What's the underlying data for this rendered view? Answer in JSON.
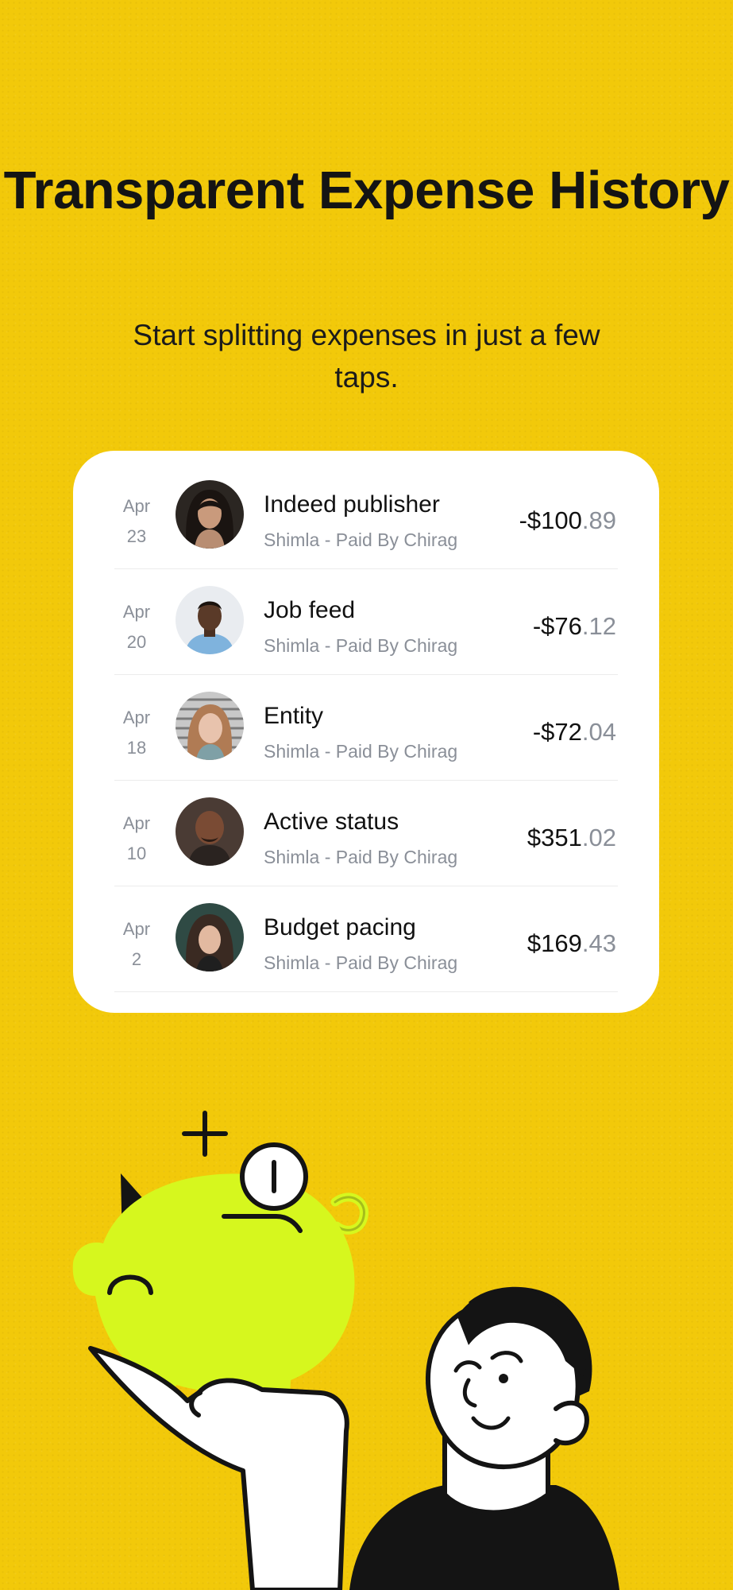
{
  "header": {
    "title": "Transparent Expense History",
    "subtitle": "Start splitting expenses in just a few taps."
  },
  "expenses": [
    {
      "month": "Apr",
      "day": "23",
      "title": "Indeed publisher",
      "subtitle": "Shimla - Paid By Chirag",
      "amount_int": "-$100",
      "amount_dec": ".89"
    },
    {
      "month": "Apr",
      "day": "20",
      "title": "Job feed",
      "subtitle": "Shimla - Paid By Chirag",
      "amount_int": "-$76",
      "amount_dec": ".12"
    },
    {
      "month": "Apr",
      "day": "18",
      "title": "Entity",
      "subtitle": "Shimla - Paid By Chirag",
      "amount_int": "-$72",
      "amount_dec": ".04"
    },
    {
      "month": "Apr",
      "day": "10",
      "title": "Active status",
      "subtitle": "Shimla - Paid By Chirag",
      "amount_int": "$351",
      "amount_dec": ".02"
    },
    {
      "month": "Apr",
      "day": "2",
      "title": "Budget pacing",
      "subtitle": "Shimla - Paid By Chirag",
      "amount_int": "$169",
      "amount_dec": ".43"
    }
  ],
  "colors": {
    "background": "#F2C90A",
    "card": "#FFFFFF",
    "piggy": "#D6F71E",
    "muted_text": "#8A8F98"
  },
  "illustration": {
    "icon": "piggy-bank-illustration"
  }
}
